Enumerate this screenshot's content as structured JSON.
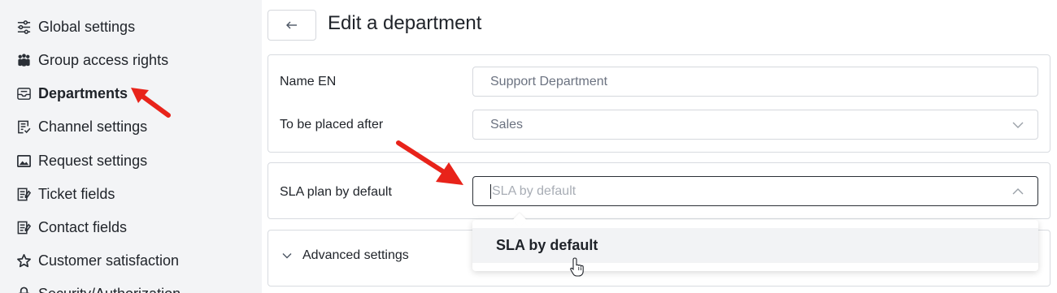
{
  "sidebar": {
    "items": [
      {
        "label": "Global settings",
        "icon": "sliders-icon"
      },
      {
        "label": "Group access rights",
        "icon": "users-group-icon"
      },
      {
        "label": "Departments",
        "icon": "inbox-tray-icon",
        "active": true
      },
      {
        "label": "Channel settings",
        "icon": "checklist-icon"
      },
      {
        "label": "Request settings",
        "icon": "image-box-icon"
      },
      {
        "label": "Ticket fields",
        "icon": "form-fields-icon"
      },
      {
        "label": "Contact fields",
        "icon": "form-fields-icon"
      },
      {
        "label": "Customer satisfaction",
        "icon": "star-icon"
      },
      {
        "label": "Security/Authorization",
        "icon": "lock-icon"
      }
    ]
  },
  "header": {
    "title": "Edit a department",
    "back_icon": "arrow-left-icon"
  },
  "form": {
    "name_label": "Name EN",
    "name_value": "Support Department",
    "placed_after_label": "To be placed after",
    "placed_after_value": "Sales",
    "sla_label": "SLA plan by default",
    "sla_placeholder": "SLA by default",
    "advanced_label": "Advanced settings"
  },
  "dropdown": {
    "options": [
      "SLA by default"
    ]
  },
  "colors": {
    "sidebar_bg": "#f3f4f6",
    "annotation_arrow": "#e8231a",
    "border": "#d5d8dd"
  }
}
